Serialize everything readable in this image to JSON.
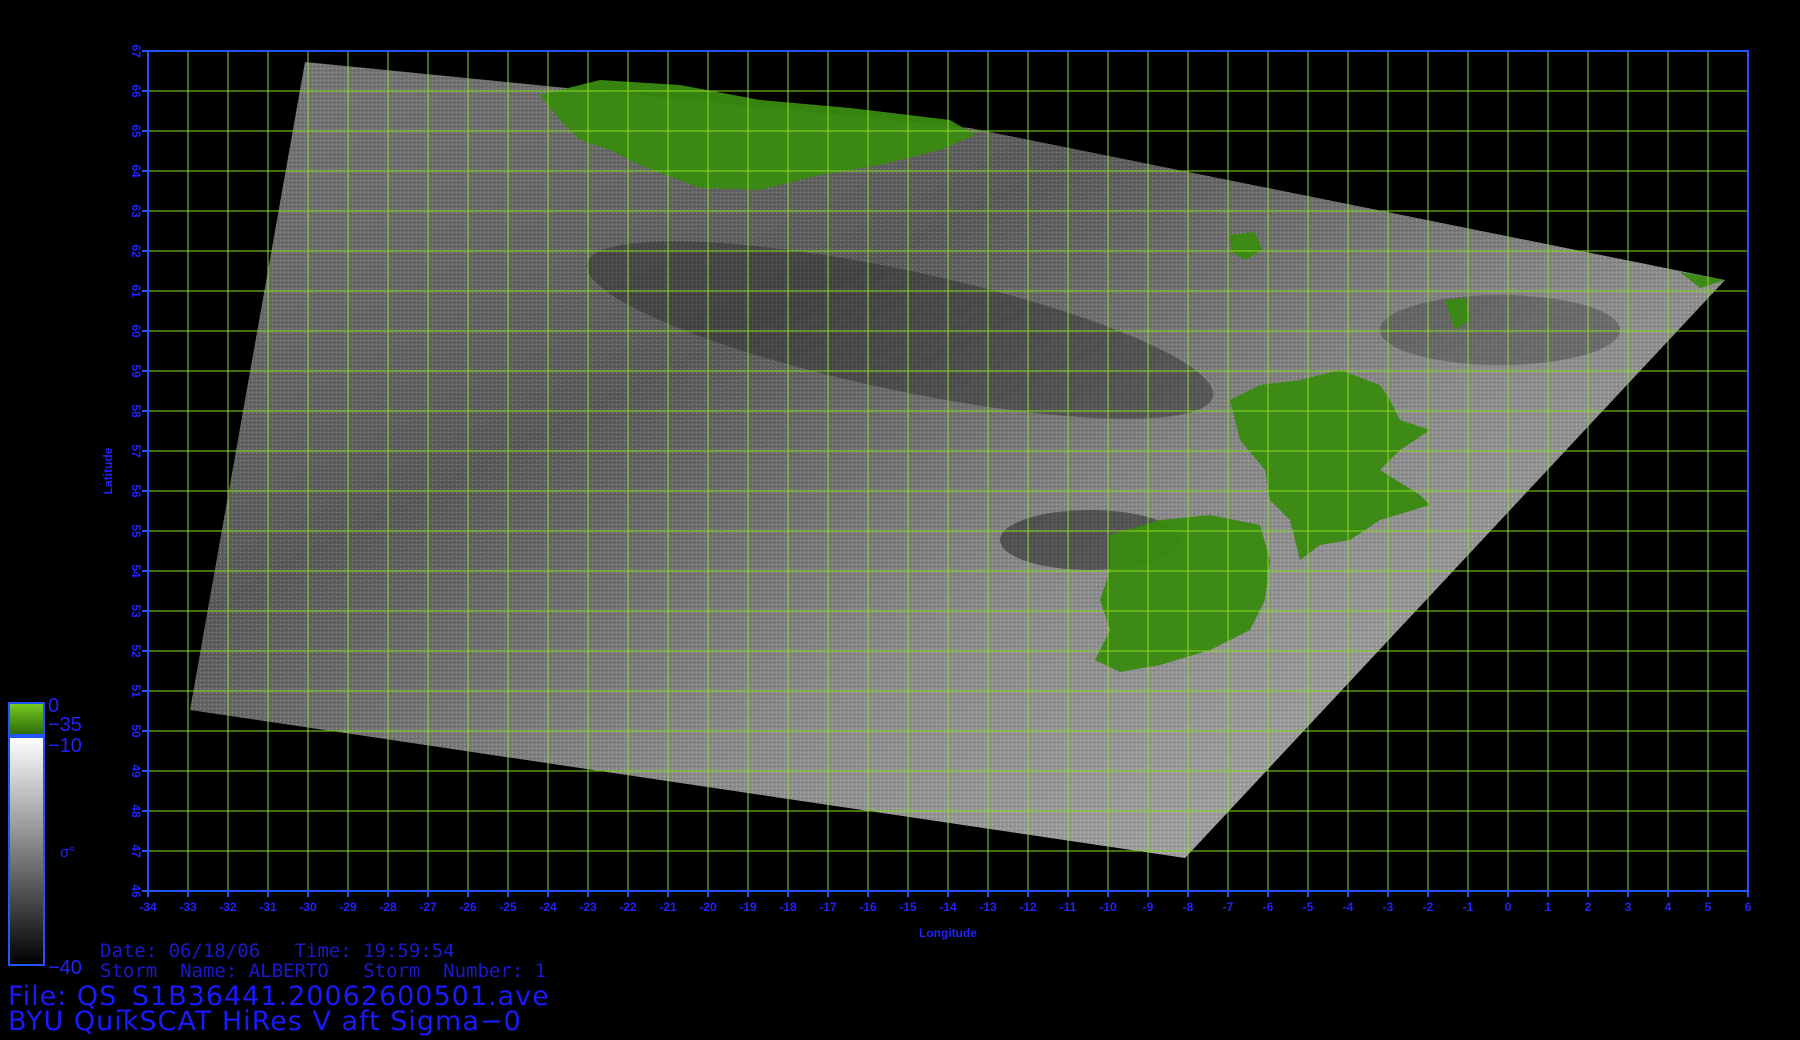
{
  "map": {
    "lon_ticks": [
      "-34",
      "-33",
      "-32",
      "-31",
      "-30",
      "-29",
      "-28",
      "-27",
      "-26",
      "-25",
      "-24",
      "-23",
      "-22",
      "-21",
      "-20",
      "-19",
      "-18",
      "-17",
      "-16",
      "-15",
      "-14",
      "-13",
      "-12",
      "-11",
      "-10",
      "-9",
      "-8",
      "-7",
      "-6",
      "-5",
      "-4",
      "-3",
      "-2",
      "-1",
      "0",
      "1",
      "2",
      "3",
      "4",
      "5",
      "6"
    ],
    "lat_ticks": [
      "46",
      "47",
      "48",
      "49",
      "50",
      "51",
      "52",
      "53",
      "54",
      "55",
      "56",
      "57",
      "58",
      "59",
      "60",
      "61",
      "62",
      "63",
      "64",
      "65",
      "66",
      "67"
    ],
    "xlabel": "Longitude",
    "ylabel": "Latitude",
    "lon_range": [
      -34,
      6
    ],
    "lat_range": [
      46,
      67
    ],
    "grid_color": "#88dd22",
    "frame_color": "#2255ff",
    "land_color": "#3a8a10"
  },
  "colorbar": {
    "land_top": "0",
    "land_bottom": "−35",
    "sea_top": "−10",
    "sea_bottom": "−40",
    "symbol": "σ°"
  },
  "info": {
    "date_line": "Date: 06/18/06   Time: 19:59:54",
    "storm_line": "Storm  Name: ALBERTO   Storm  Number: 1"
  },
  "footer": {
    "file_line": "File: QS_S1B36441.20062600501.ave",
    "title_line": "BYU QuikSCAT HiRes V aft Sigma−0"
  }
}
